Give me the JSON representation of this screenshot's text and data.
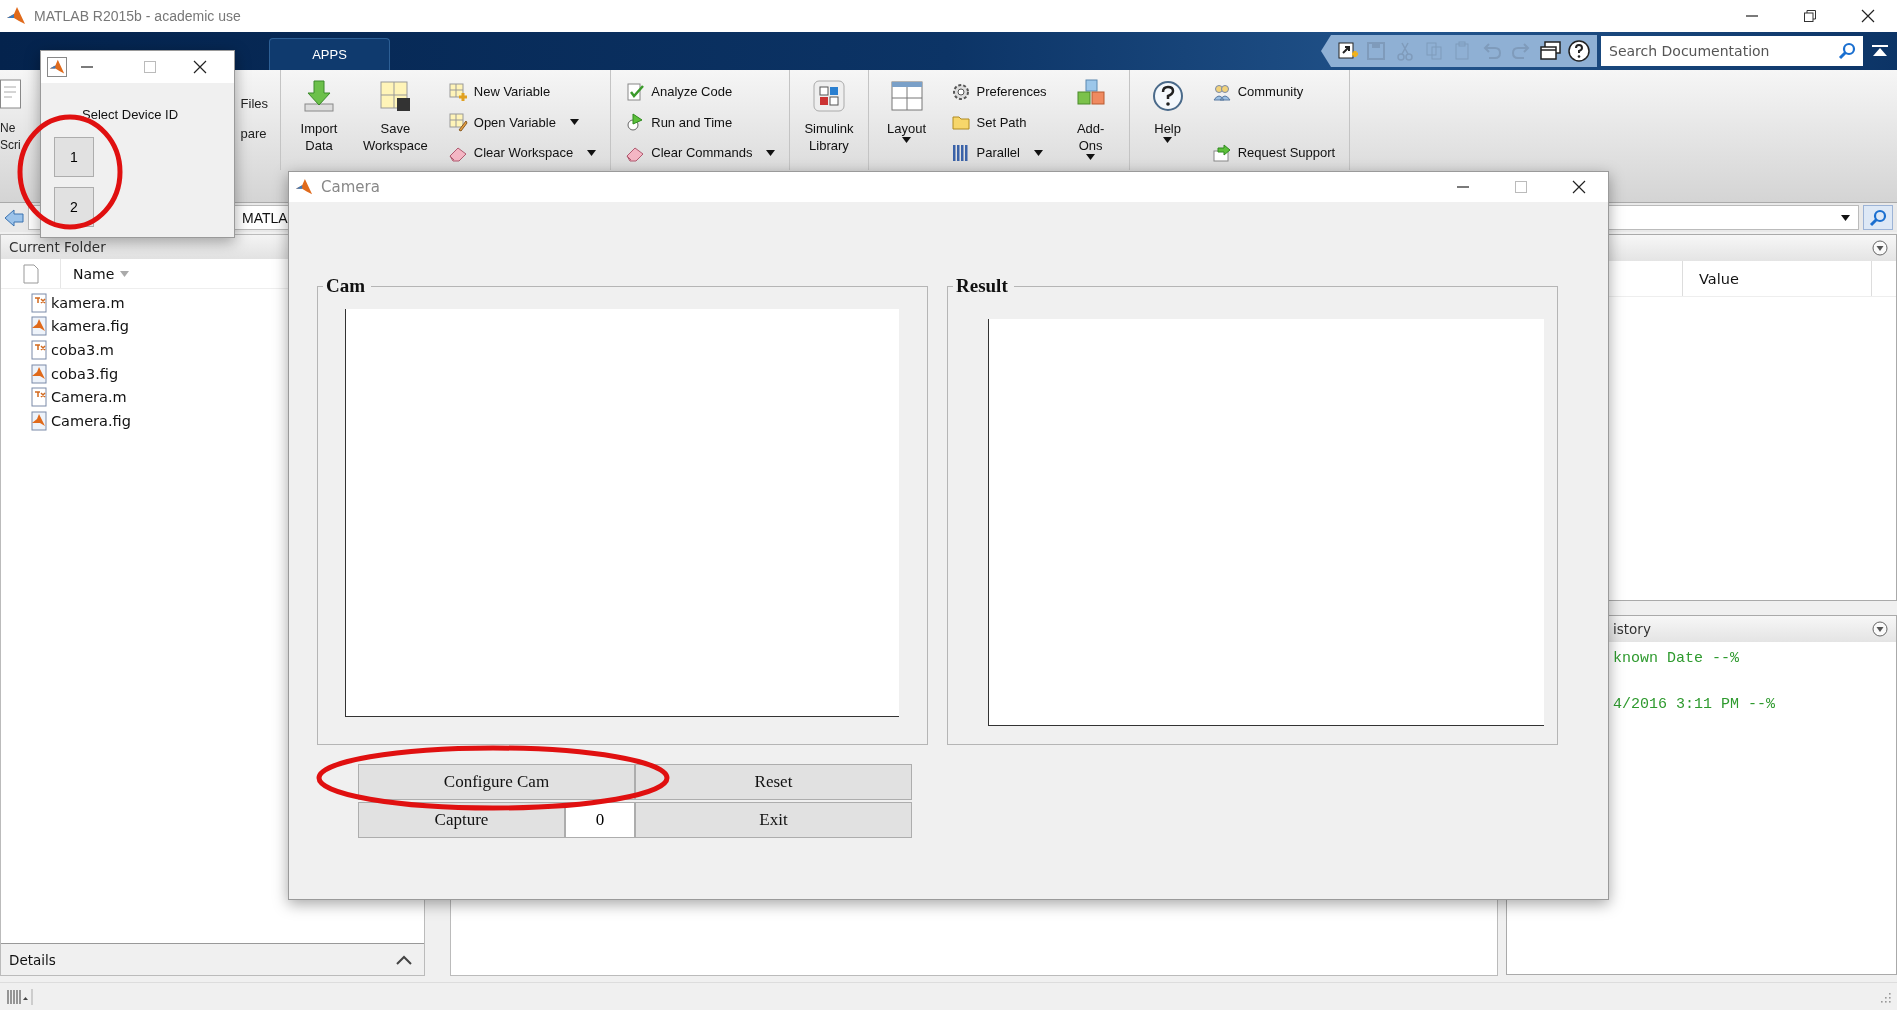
{
  "window": {
    "title": "MATLAB R2015b - academic use"
  },
  "tabs": [
    {
      "label": "APPS",
      "selected": false
    }
  ],
  "search": {
    "placeholder": "Search Documentation"
  },
  "ribbon": {
    "groups": [
      [
        {
          "kind": "clipped",
          "lines": [
            "Ne",
            "Scri"
          ]
        },
        {
          "kind": "clipped_list",
          "items": [
            {
              "label": "Files"
            },
            {
              "label": "pare"
            }
          ]
        }
      ],
      [
        {
          "kind": "large",
          "items": [
            {
              "label": "Import Data",
              "dropdown": false
            },
            {
              "label": "Save Workspace",
              "dropdown": false
            }
          ]
        },
        {
          "kind": "list",
          "items": [
            {
              "label": "New Variable",
              "dropdown": false
            },
            {
              "label": "Open Variable",
              "dropdown": true
            },
            {
              "label": "Clear Workspace",
              "dropdown": true
            }
          ]
        }
      ],
      [
        {
          "kind": "list",
          "items": [
            {
              "label": "Analyze Code",
              "dropdown": false
            },
            {
              "label": "Run and Time",
              "dropdown": false
            },
            {
              "label": "Clear Commands",
              "dropdown": true
            }
          ]
        }
      ],
      [
        {
          "kind": "large",
          "items": [
            {
              "label": "Simulink Library",
              "dropdown": false
            }
          ]
        }
      ],
      [
        {
          "kind": "large",
          "items": [
            {
              "label": "Layout",
              "dropdown": true
            }
          ]
        },
        {
          "kind": "list",
          "items": [
            {
              "label": "Preferences",
              "dropdown": false
            },
            {
              "label": "Set Path",
              "dropdown": false
            },
            {
              "label": "Parallel",
              "dropdown": true
            }
          ]
        },
        {
          "kind": "large",
          "items": [
            {
              "label": "Add-Ons",
              "dropdown": true
            }
          ]
        }
      ],
      [
        {
          "kind": "large",
          "items": [
            {
              "label": "Help",
              "dropdown": true
            }
          ]
        },
        {
          "kind": "list",
          "items": [
            {
              "label": "Community",
              "dropdown": false
            },
            {
              "label": "Request Support",
              "dropdown": false
            }
          ]
        }
      ]
    ]
  },
  "address_bar": {
    "path": "MATLA"
  },
  "current_folder": {
    "title": "Current Folder",
    "column": "Name",
    "files": [
      {
        "name": "kamera.m",
        "kind": "script"
      },
      {
        "name": "kamera.fig",
        "kind": "figure"
      },
      {
        "name": "coba3.m",
        "kind": "script"
      },
      {
        "name": "coba3.fig",
        "kind": "figure"
      },
      {
        "name": "Camera.m",
        "kind": "script"
      },
      {
        "name": "Camera.fig",
        "kind": "figure"
      }
    ],
    "details": "Details"
  },
  "workspace": {
    "column": "Value"
  },
  "history": {
    "title": "istory",
    "lines": [
      "known Date --%",
      "4/2016 3:11 PM --%"
    ]
  },
  "camera_window": {
    "title": "Camera",
    "panels": [
      {
        "title": "Cam"
      },
      {
        "title": "Result"
      }
    ],
    "buttons": [
      {
        "label": "Configure Cam"
      },
      {
        "label": "Reset"
      },
      {
        "label": "Capture"
      },
      {
        "label": "Exit"
      }
    ],
    "counter": "0"
  },
  "device_dialog": {
    "prompt": "Select Device ID",
    "buttons": [
      "1",
      "2"
    ]
  },
  "annotations": [
    {
      "kind": "ellipse"
    },
    {
      "kind": "ellipse"
    }
  ]
}
